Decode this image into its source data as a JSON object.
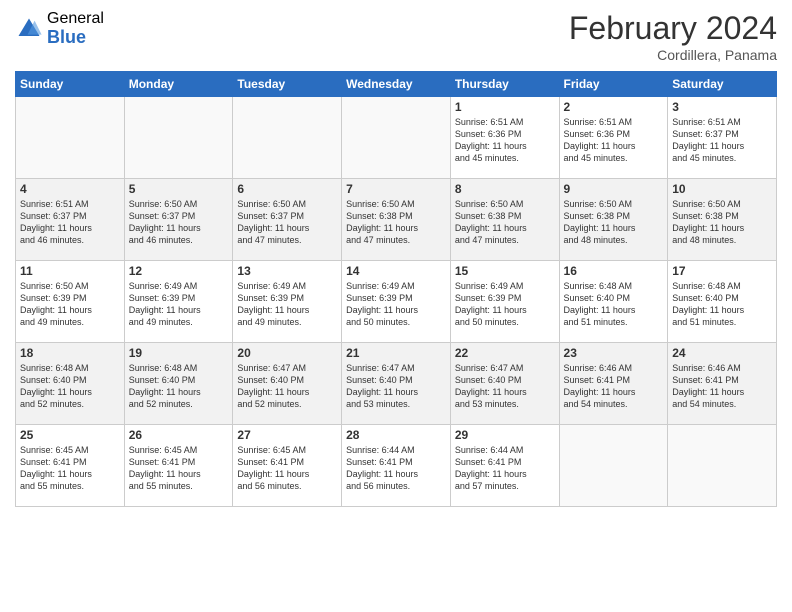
{
  "header": {
    "logo_general": "General",
    "logo_blue": "Blue",
    "month_title": "February 2024",
    "subtitle": "Cordillera, Panama"
  },
  "weekdays": [
    "Sunday",
    "Monday",
    "Tuesday",
    "Wednesday",
    "Thursday",
    "Friday",
    "Saturday"
  ],
  "weeks": [
    [
      {
        "day": "",
        "info": ""
      },
      {
        "day": "",
        "info": ""
      },
      {
        "day": "",
        "info": ""
      },
      {
        "day": "",
        "info": ""
      },
      {
        "day": "1",
        "info": "Sunrise: 6:51 AM\nSunset: 6:36 PM\nDaylight: 11 hours\nand 45 minutes."
      },
      {
        "day": "2",
        "info": "Sunrise: 6:51 AM\nSunset: 6:36 PM\nDaylight: 11 hours\nand 45 minutes."
      },
      {
        "day": "3",
        "info": "Sunrise: 6:51 AM\nSunset: 6:37 PM\nDaylight: 11 hours\nand 45 minutes."
      }
    ],
    [
      {
        "day": "4",
        "info": "Sunrise: 6:51 AM\nSunset: 6:37 PM\nDaylight: 11 hours\nand 46 minutes."
      },
      {
        "day": "5",
        "info": "Sunrise: 6:50 AM\nSunset: 6:37 PM\nDaylight: 11 hours\nand 46 minutes."
      },
      {
        "day": "6",
        "info": "Sunrise: 6:50 AM\nSunset: 6:37 PM\nDaylight: 11 hours\nand 47 minutes."
      },
      {
        "day": "7",
        "info": "Sunrise: 6:50 AM\nSunset: 6:38 PM\nDaylight: 11 hours\nand 47 minutes."
      },
      {
        "day": "8",
        "info": "Sunrise: 6:50 AM\nSunset: 6:38 PM\nDaylight: 11 hours\nand 47 minutes."
      },
      {
        "day": "9",
        "info": "Sunrise: 6:50 AM\nSunset: 6:38 PM\nDaylight: 11 hours\nand 48 minutes."
      },
      {
        "day": "10",
        "info": "Sunrise: 6:50 AM\nSunset: 6:38 PM\nDaylight: 11 hours\nand 48 minutes."
      }
    ],
    [
      {
        "day": "11",
        "info": "Sunrise: 6:50 AM\nSunset: 6:39 PM\nDaylight: 11 hours\nand 49 minutes."
      },
      {
        "day": "12",
        "info": "Sunrise: 6:49 AM\nSunset: 6:39 PM\nDaylight: 11 hours\nand 49 minutes."
      },
      {
        "day": "13",
        "info": "Sunrise: 6:49 AM\nSunset: 6:39 PM\nDaylight: 11 hours\nand 49 minutes."
      },
      {
        "day": "14",
        "info": "Sunrise: 6:49 AM\nSunset: 6:39 PM\nDaylight: 11 hours\nand 50 minutes."
      },
      {
        "day": "15",
        "info": "Sunrise: 6:49 AM\nSunset: 6:39 PM\nDaylight: 11 hours\nand 50 minutes."
      },
      {
        "day": "16",
        "info": "Sunrise: 6:48 AM\nSunset: 6:40 PM\nDaylight: 11 hours\nand 51 minutes."
      },
      {
        "day": "17",
        "info": "Sunrise: 6:48 AM\nSunset: 6:40 PM\nDaylight: 11 hours\nand 51 minutes."
      }
    ],
    [
      {
        "day": "18",
        "info": "Sunrise: 6:48 AM\nSunset: 6:40 PM\nDaylight: 11 hours\nand 52 minutes."
      },
      {
        "day": "19",
        "info": "Sunrise: 6:48 AM\nSunset: 6:40 PM\nDaylight: 11 hours\nand 52 minutes."
      },
      {
        "day": "20",
        "info": "Sunrise: 6:47 AM\nSunset: 6:40 PM\nDaylight: 11 hours\nand 52 minutes."
      },
      {
        "day": "21",
        "info": "Sunrise: 6:47 AM\nSunset: 6:40 PM\nDaylight: 11 hours\nand 53 minutes."
      },
      {
        "day": "22",
        "info": "Sunrise: 6:47 AM\nSunset: 6:40 PM\nDaylight: 11 hours\nand 53 minutes."
      },
      {
        "day": "23",
        "info": "Sunrise: 6:46 AM\nSunset: 6:41 PM\nDaylight: 11 hours\nand 54 minutes."
      },
      {
        "day": "24",
        "info": "Sunrise: 6:46 AM\nSunset: 6:41 PM\nDaylight: 11 hours\nand 54 minutes."
      }
    ],
    [
      {
        "day": "25",
        "info": "Sunrise: 6:45 AM\nSunset: 6:41 PM\nDaylight: 11 hours\nand 55 minutes."
      },
      {
        "day": "26",
        "info": "Sunrise: 6:45 AM\nSunset: 6:41 PM\nDaylight: 11 hours\nand 55 minutes."
      },
      {
        "day": "27",
        "info": "Sunrise: 6:45 AM\nSunset: 6:41 PM\nDaylight: 11 hours\nand 56 minutes."
      },
      {
        "day": "28",
        "info": "Sunrise: 6:44 AM\nSunset: 6:41 PM\nDaylight: 11 hours\nand 56 minutes."
      },
      {
        "day": "29",
        "info": "Sunrise: 6:44 AM\nSunset: 6:41 PM\nDaylight: 11 hours\nand 57 minutes."
      },
      {
        "day": "",
        "info": ""
      },
      {
        "day": "",
        "info": ""
      }
    ]
  ]
}
